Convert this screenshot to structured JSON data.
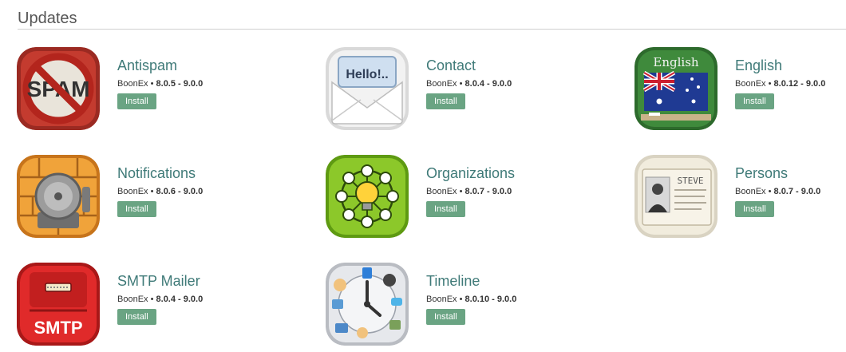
{
  "section": {
    "title": "Updates"
  },
  "modules": [
    {
      "name": "Antispam",
      "vendor": "BoonEx",
      "separator": "•",
      "version": "8.0.5 - 9.0.0",
      "install_label": "Install",
      "icon": "spam-icon"
    },
    {
      "name": "Contact",
      "vendor": "BoonEx",
      "separator": "•",
      "version": "8.0.4 - 9.0.0",
      "install_label": "Install",
      "icon": "envelope-icon",
      "icon_text": "Hello!.."
    },
    {
      "name": "English",
      "vendor": "BoonEx",
      "separator": "•",
      "version": "8.0.12 - 9.0.0",
      "install_label": "Install",
      "icon": "chalkboard-flag-icon",
      "icon_text": "English"
    },
    {
      "name": "Notifications",
      "vendor": "BoonEx",
      "separator": "•",
      "version": "8.0.6 - 9.0.0",
      "install_label": "Install",
      "icon": "bell-icon"
    },
    {
      "name": "Organizations",
      "vendor": "BoonEx",
      "separator": "•",
      "version": "8.0.7 - 9.0.0",
      "install_label": "Install",
      "icon": "lightbulb-network-icon"
    },
    {
      "name": "Persons",
      "vendor": "BoonEx",
      "separator": "•",
      "version": "8.0.7 - 9.0.0",
      "install_label": "Install",
      "icon": "id-card-icon",
      "icon_text": "STEVE"
    },
    {
      "name": "SMTP Mailer",
      "vendor": "BoonEx",
      "separator": "•",
      "version": "8.0.4 - 9.0.0",
      "install_label": "Install",
      "icon": "mailbox-icon",
      "icon_text": "SMTP"
    },
    {
      "name": "Timeline",
      "vendor": "BoonEx",
      "separator": "•",
      "version": "8.0.10 - 9.0.0",
      "install_label": "Install",
      "icon": "clock-icon"
    }
  ],
  "colors": {
    "title_link": "#3f7a78",
    "install_button": "#6aa483",
    "divider": "#cfcfcf"
  }
}
